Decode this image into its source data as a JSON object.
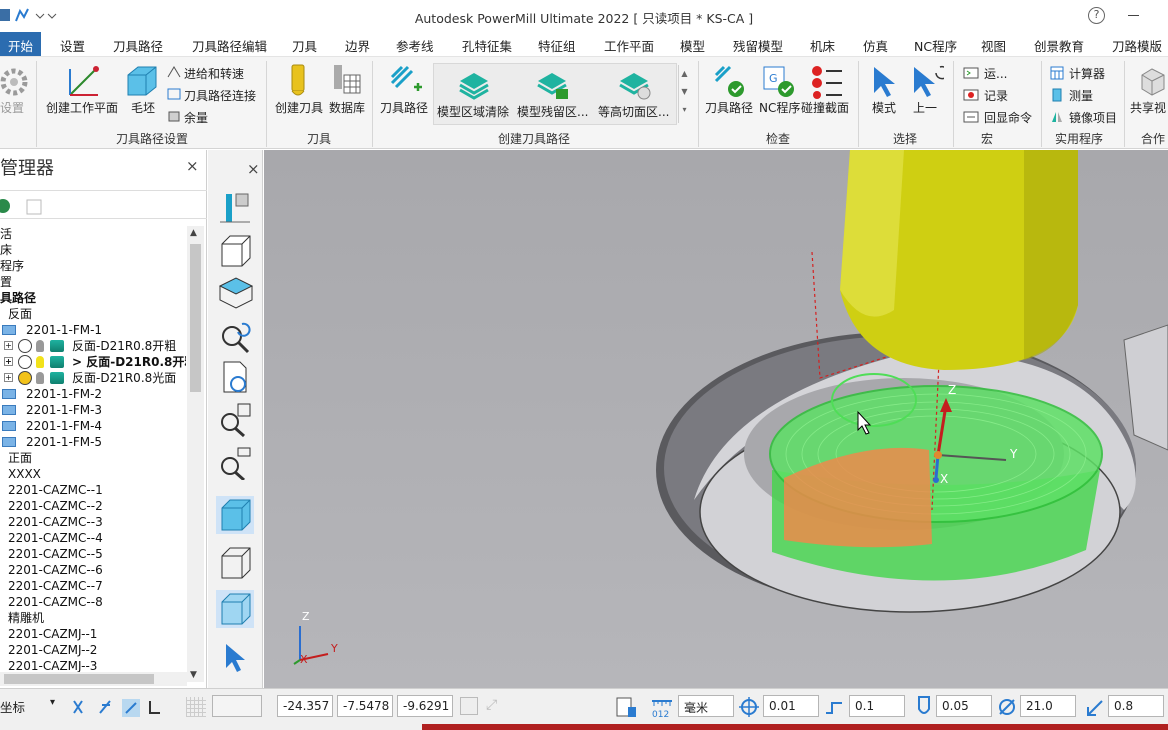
{
  "window": {
    "title": "Autodesk PowerMill Ultimate 2022    [ 只读项目 * KS-CA ]"
  },
  "tabs": [
    "开始",
    "设置",
    "刀具路径",
    "刀具路径编辑",
    "刀具",
    "边界",
    "参考线",
    "孔特征集",
    "特征组",
    "工作平面",
    "模型",
    "残留模型",
    "机床",
    "仿真",
    "NC程序",
    "视图",
    "创景教育",
    "刀路模版"
  ],
  "ribbon": {
    "settings": "设置",
    "create_workplane": "创建工作平面",
    "stock": "毛坯",
    "feeds_speeds": "进给和转速",
    "toolpath_connections": "刀具路径连接",
    "thickness": "余量",
    "group_toolpath_setup": "刀具路径设置",
    "create_tool": "创建刀具",
    "database": "数据库",
    "group_tool": "刀具",
    "toolpath": "刀具路径",
    "model_area_clear": "模型区域清除",
    "model_rest_area": "模型残留区...",
    "constant_z": "等高切面区...",
    "group_create_toolpath": "创建刀具路径",
    "verify_toolpath": "刀具路径",
    "nc_program": "NC程序",
    "collision_section": "碰撞截面",
    "group_check": "检查",
    "mode": "模式",
    "previous": "上一",
    "group_select": "选择",
    "run": "运...",
    "record": "记录",
    "echo_commands": "回显命令",
    "group_macro": "宏",
    "calculator": "计算器",
    "measure": "测量",
    "mirror_item": "镜像项目",
    "group_utilities": "实用程序",
    "share_view": "共享视",
    "group_collab": "合作"
  },
  "explorer": {
    "title": "管理器",
    "rows": [
      {
        "text": "活",
        "indent": 0,
        "bold": false
      },
      {
        "text": "床",
        "indent": 0,
        "bold": false
      },
      {
        "text": "程序",
        "indent": 0,
        "bold": false
      },
      {
        "text": "置",
        "indent": 0,
        "bold": false
      },
      {
        "text": "具路径",
        "indent": 0,
        "bold": true
      },
      {
        "text": "反面",
        "indent": 8,
        "bold": false
      },
      {
        "text": "2201-1-FM-1",
        "indent": 26,
        "bold": false
      },
      {
        "text": "反面-D21R0.8开粗",
        "indent": 72,
        "bold": false
      },
      {
        "text": "> 反面-D21R0.8开粗",
        "indent": 72,
        "bold": true
      },
      {
        "text": "反面-D21R0.8光面",
        "indent": 72,
        "bold": false
      },
      {
        "text": "2201-1-FM-2",
        "indent": 26,
        "bold": false
      },
      {
        "text": "2201-1-FM-3",
        "indent": 26,
        "bold": false
      },
      {
        "text": "2201-1-FM-4",
        "indent": 26,
        "bold": false
      },
      {
        "text": "2201-1-FM-5",
        "indent": 26,
        "bold": false
      },
      {
        "text": "正面",
        "indent": 8,
        "bold": false
      },
      {
        "text": "XXXX",
        "indent": 8,
        "bold": false
      },
      {
        "text": "2201-CAZMC--1",
        "indent": 8,
        "bold": false
      },
      {
        "text": "2201-CAZMC--2",
        "indent": 8,
        "bold": false
      },
      {
        "text": "2201-CAZMC--3",
        "indent": 8,
        "bold": false
      },
      {
        "text": "2201-CAZMC--4",
        "indent": 8,
        "bold": false
      },
      {
        "text": "2201-CAZMC--5",
        "indent": 8,
        "bold": false
      },
      {
        "text": "2201-CAZMC--6",
        "indent": 8,
        "bold": false
      },
      {
        "text": "2201-CAZMC--7",
        "indent": 8,
        "bold": false
      },
      {
        "text": "2201-CAZMC--8",
        "indent": 8,
        "bold": false
      },
      {
        "text": "精雕机",
        "indent": 8,
        "bold": false
      },
      {
        "text": "2201-CAZMJ--1",
        "indent": 8,
        "bold": false
      },
      {
        "text": "2201-CAZMJ--2",
        "indent": 8,
        "bold": false
      },
      {
        "text": "2201-CAZMJ--3",
        "indent": 8,
        "bold": false
      }
    ]
  },
  "viewport": {
    "axis_z": "Z",
    "axis_y": "Y",
    "axis_x": "X"
  },
  "status": {
    "coord_mode": "坐标",
    "x": "-24.357",
    "y": "-7.5478",
    "z": "-9.6291",
    "units": "毫米",
    "tolerance": "0.01",
    "stepover": "0.1",
    "stepdown": "0.05",
    "tool_diameter": "21.0",
    "tip_radius": "0.8"
  }
}
